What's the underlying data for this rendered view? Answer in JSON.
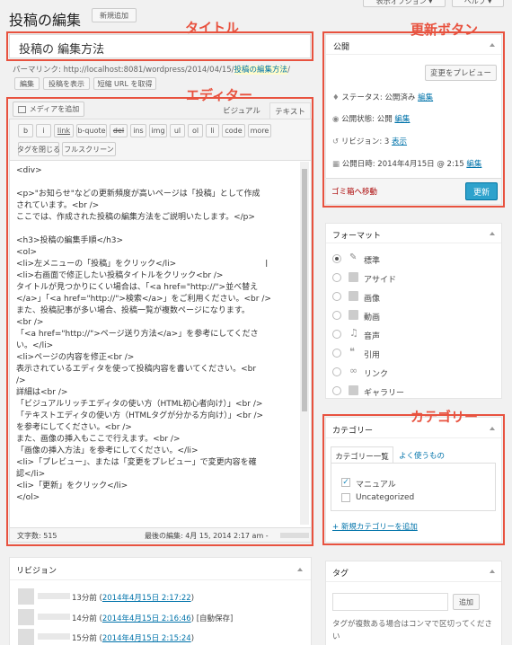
{
  "header": {
    "title": "投稿の編集",
    "new_post": "新規追加",
    "display_options": "表示オプション ▾",
    "help": "ヘルプ ▾"
  },
  "post_title": {
    "value": "投稿の 編集方法"
  },
  "permalink": {
    "label": "パーマリンク:",
    "url": "http://localhost:8081/wordpress/2014/04/15/",
    "slug": "投稿の編集方法",
    "edit": "編集",
    "view": "投稿を表示",
    "shortlink": "短縮 URL を取得"
  },
  "editor": {
    "add_media": "メディアを追加",
    "tab_visual": "ビジュアル",
    "tab_text": "テキスト",
    "quicktags": [
      "b",
      "i",
      "link",
      "b-quote",
      "del",
      "ins",
      "img",
      "ul",
      "ol",
      "li",
      "code",
      "more"
    ],
    "close_tags": "タグを閉じる",
    "fullscreen": "フルスクリーン",
    "lines": [
      "<div>",
      "",
      "<p>\"お知らせ\"などの更新頻度が高いページは「投稿」として作成",
      "されています。<br />",
      "ここでは、作成された投稿の編集方法をご説明いたします。</p>",
      "",
      "<h3>投稿の編集手順</h3>",
      "<ol>",
      "<li>左メニューの「投稿」をクリック</li>",
      "<li>右画面で修正したい投稿タイトルをクリック<br />",
      "タイトルが見つかりにくい場合は、「<a href=\"http://\">並べ替え",
      "</a>」「<a href=\"http://\">検索</a>」をご利用ください。<br />",
      "また、投稿記事が多い場合、投稿一覧が複数ページになります。",
      "<br />",
      "「<a href=\"http://\">ページ送り方法</a>」を参考にしてくださ",
      "い。</li>",
      "<li>ページの内容を修正<br />",
      "表示されているエディタを使って投稿内容を書いてください。<br",
      "/>",
      "詳細は<br />",
      "「ビジュアルリッチエディタの使い方（HTML初心者向け）」<br />",
      "「テキストエディタの使い方（HTMLタグが分かる方向け）」<br />",
      "を参考にしてください。<br />",
      "また、画像の挿入もここで行えます。<br />",
      "「画像の挿入方法」を参考にしてください。</li>",
      "<li>「プレビュー」、または「変更をプレビュー」で変更内容を確",
      "認</li>",
      "<li>「更新」をクリック</li>",
      "</ol>"
    ],
    "word_count": "文字数: 515",
    "last_edit": "最後の編集: 4月 15, 2014 2:17 am -"
  },
  "publish": {
    "title": "公開",
    "preview_changes": "変更をプレビュー",
    "status_label": "ステータス: 公開済み",
    "status_edit": "編集",
    "visibility_label": "公開状態: 公開",
    "visibility_edit": "編集",
    "revisions_label": "リビジョン: 3",
    "revisions_show": "表示",
    "date_label": "公開日時: 2014年4月15日 @ 2:15",
    "date_edit": "編集",
    "trash": "ゴミ箱へ移動",
    "update": "更新"
  },
  "format": {
    "title": "フォーマット",
    "options": [
      "標準",
      "アサイド",
      "画像",
      "動画",
      "音声",
      "引用",
      "リンク",
      "ギャラリー"
    ]
  },
  "categories": {
    "title": "カテゴリー",
    "tab_all": "カテゴリー一覧",
    "tab_popular": "よく使うもの",
    "items": [
      {
        "label": "マニュアル",
        "checked": true
      },
      {
        "label": "Uncategorized",
        "checked": false
      }
    ],
    "add_new": "+ 新規カテゴリーを追加"
  },
  "tags": {
    "title": "タグ",
    "add": "追加",
    "hint": "タグが複数ある場合はコンマで区切ってくださ",
    "hint2": "い"
  },
  "revisions": {
    "title": "リビジョン",
    "items": [
      {
        "ago": "13分前",
        "link": "2014年4月15日 2:17:22",
        "note": ""
      },
      {
        "ago": "14分前",
        "link": "2014年4月15日 2:16:46",
        "note": "[自動保存]"
      },
      {
        "ago": "15分前",
        "link": "2014年4月15日 2:15:24",
        "note": ""
      }
    ]
  },
  "annotations": {
    "title": "タイトル",
    "update_btn": "更新ボタン",
    "editor": "エディター",
    "category": "カテゴリー"
  },
  "colors": {
    "accent": "#e8523f",
    "link": "#0073aa",
    "primary_btn": "#2ea2cc"
  }
}
